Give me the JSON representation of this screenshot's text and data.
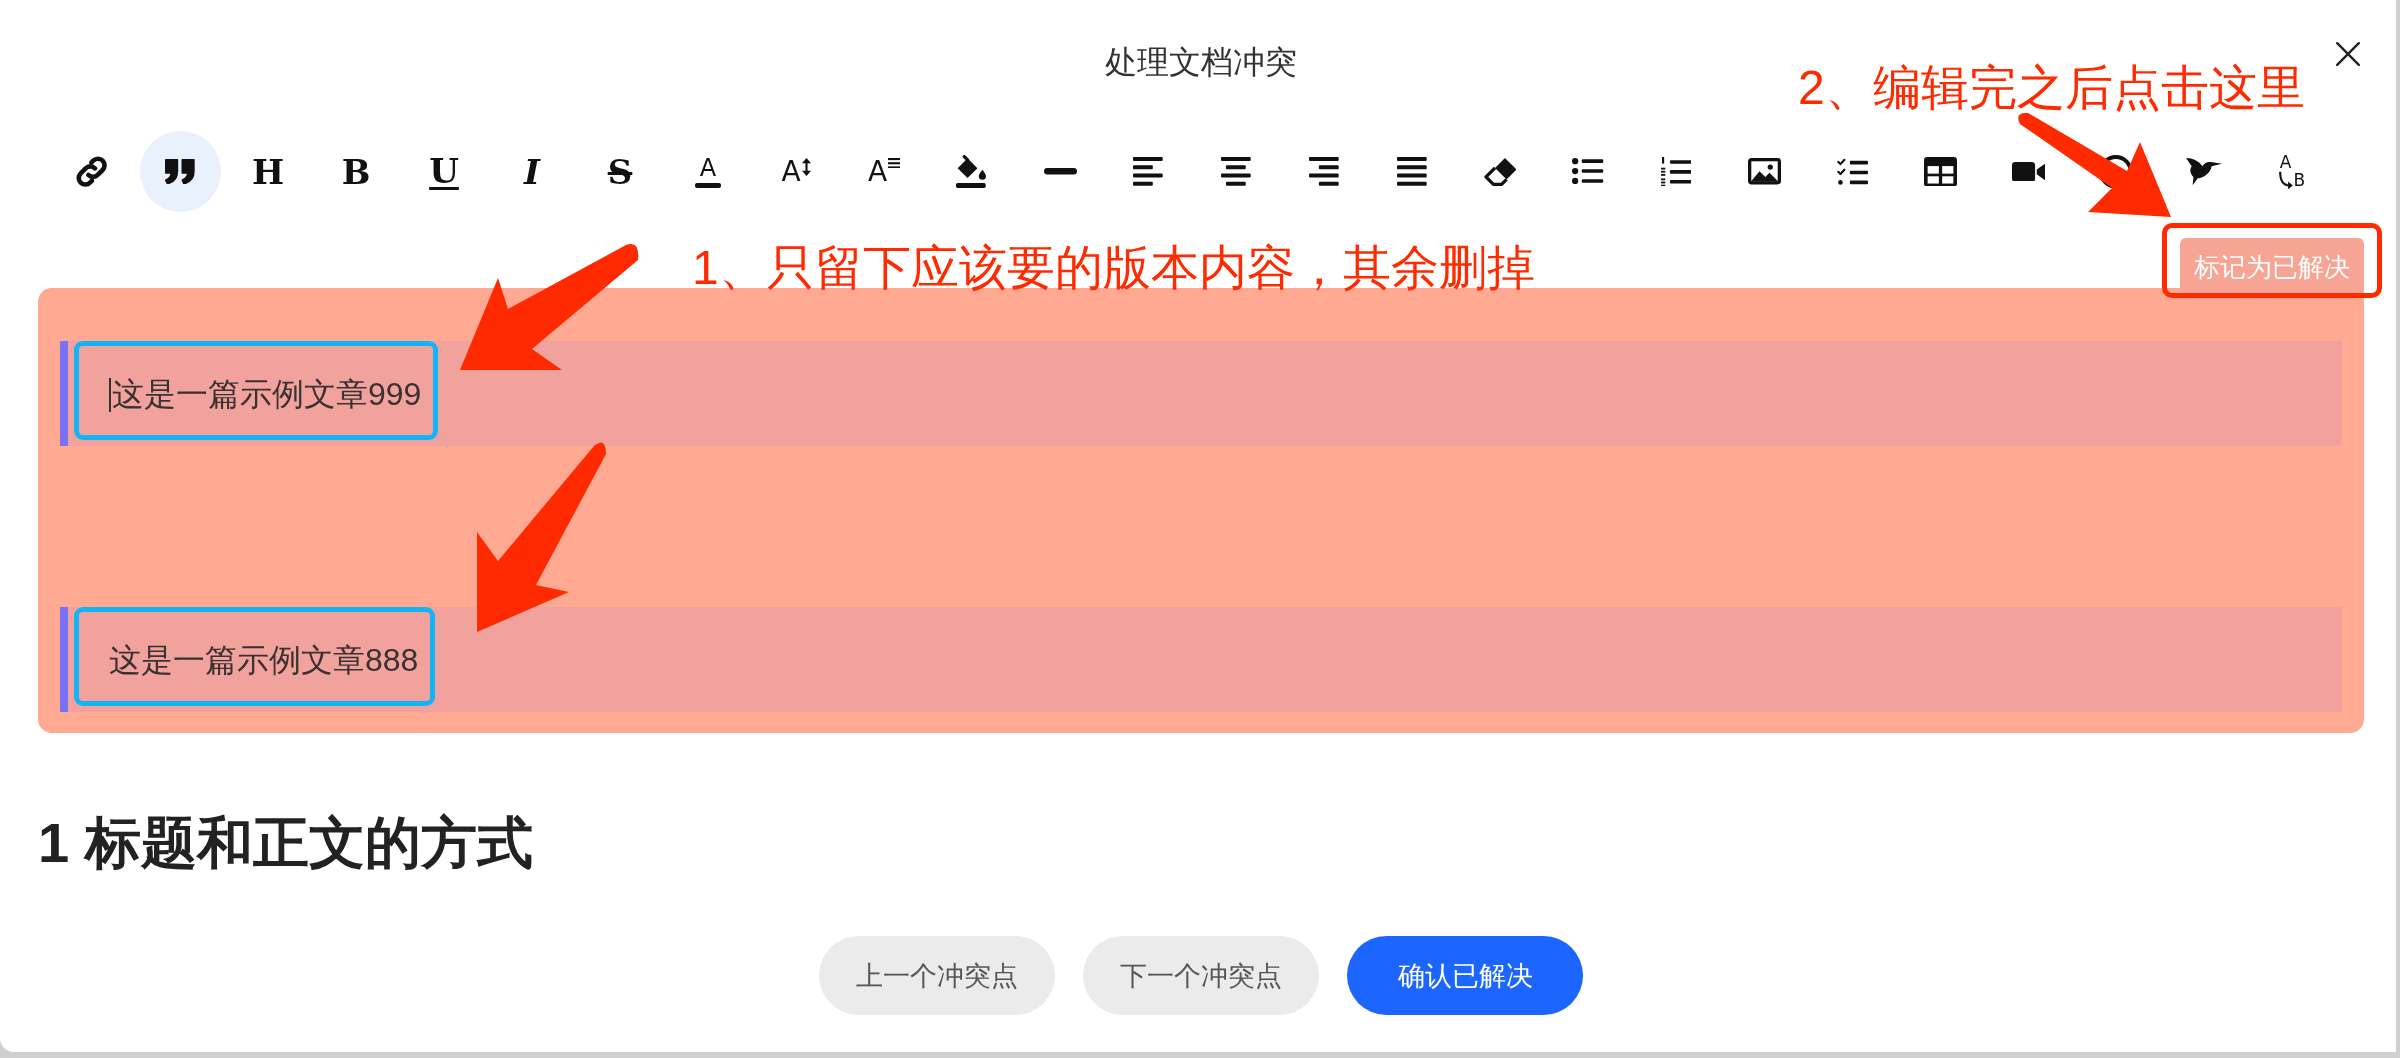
{
  "dialog": {
    "title": "处理文档冲突"
  },
  "toolbar": {
    "tools": [
      {
        "kind": "link",
        "on": false
      },
      {
        "kind": "quote",
        "on": true
      },
      {
        "kind": "heading",
        "glyph": "H",
        "on": false
      },
      {
        "kind": "bold",
        "glyph": "B",
        "on": false
      },
      {
        "kind": "underline",
        "glyph": "U",
        "on": false
      },
      {
        "kind": "italic",
        "glyph": "I",
        "on": false
      },
      {
        "kind": "strike",
        "glyph": "S",
        "on": false
      },
      {
        "kind": "color",
        "glyph": "A",
        "on": false
      },
      {
        "kind": "size",
        "glyph": "A",
        "on": false
      },
      {
        "kind": "spacing",
        "glyph": "A",
        "on": false
      },
      {
        "kind": "fill",
        "on": false
      },
      {
        "kind": "rule",
        "on": false
      },
      {
        "kind": "left",
        "on": false
      },
      {
        "kind": "center",
        "on": false
      },
      {
        "kind": "right",
        "on": false
      },
      {
        "kind": "justify",
        "on": false
      },
      {
        "kind": "eraser",
        "on": false
      },
      {
        "kind": "bullets",
        "on": false
      },
      {
        "kind": "numbers",
        "on": false
      },
      {
        "kind": "image",
        "on": false
      },
      {
        "kind": "tasks",
        "on": false
      },
      {
        "kind": "table",
        "on": false
      },
      {
        "kind": "video",
        "on": false
      },
      {
        "kind": "circle",
        "on": false
      },
      {
        "kind": "bird",
        "on": false
      },
      {
        "kind": "convert",
        "glyph": "A",
        "subglyph": "B",
        "on": false
      }
    ]
  },
  "mark_resolved_button": {
    "label": "标记为已解决",
    "highlighted": true
  },
  "conflict": {
    "versions": [
      {
        "text": "这是一篇示例文章999",
        "focused": true,
        "framed": true
      },
      {
        "text": "这是一篇示例文章888",
        "focused": false,
        "framed": true
      }
    ]
  },
  "document": {
    "heading": "1 标题和正文的方式"
  },
  "footer": {
    "buttons": [
      {
        "label": "上一个冲突点",
        "kind": "secondary"
      },
      {
        "label": "下一个冲突点",
        "kind": "secondary"
      },
      {
        "label": "确认已解决",
        "kind": "primary"
      }
    ]
  },
  "annotations": [
    {
      "text": "1、只留下应该要的版本内容，其余删掉"
    },
    {
      "text": "2、编辑完之后点击这里"
    }
  ]
}
